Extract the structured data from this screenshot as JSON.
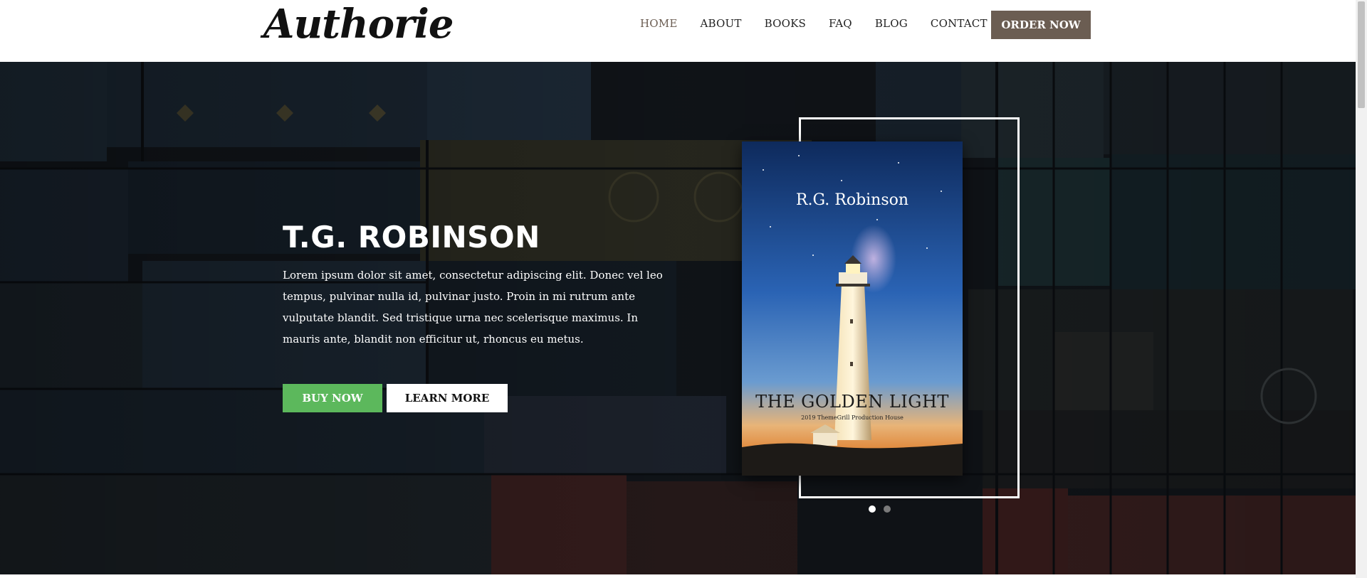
{
  "header": {
    "logo_text": "Authorie",
    "nav": [
      {
        "label": "HOME",
        "active": true
      },
      {
        "label": "ABOUT",
        "active": false
      },
      {
        "label": "BOOKS",
        "active": false
      },
      {
        "label": "FAQ",
        "active": false
      },
      {
        "label": "BLOG",
        "active": false
      },
      {
        "label": "CONTACT",
        "active": false
      }
    ],
    "order_label": "ORDER NOW"
  },
  "hero": {
    "title": "T.G. ROBINSON",
    "description": "Lorem ipsum dolor sit amet, consectetur adipiscing elit. Donec vel leo tempus, pulvinar nulla id, pulvinar justo. Proin in mi rutrum ante vulputate blandit. Sed tristique urna nec scelerisque maximus. In mauris ante, blandit non efficitur ut, rhoncus eu metus.",
    "buy_label": "BUY NOW",
    "learn_label": "LEARN MORE"
  },
  "book": {
    "author": "R.G. Robinson",
    "title": "THE GOLDEN LIGHT",
    "publisher": "2019 ThemeGrill Production House"
  },
  "slider": {
    "slides": 2,
    "active_index": 0
  },
  "colors": {
    "accent": "#6b5d52",
    "buy_green": "#5cb85c",
    "hero_text": "#ffffff"
  },
  "icons": {
    "slider_dot": "circle"
  }
}
